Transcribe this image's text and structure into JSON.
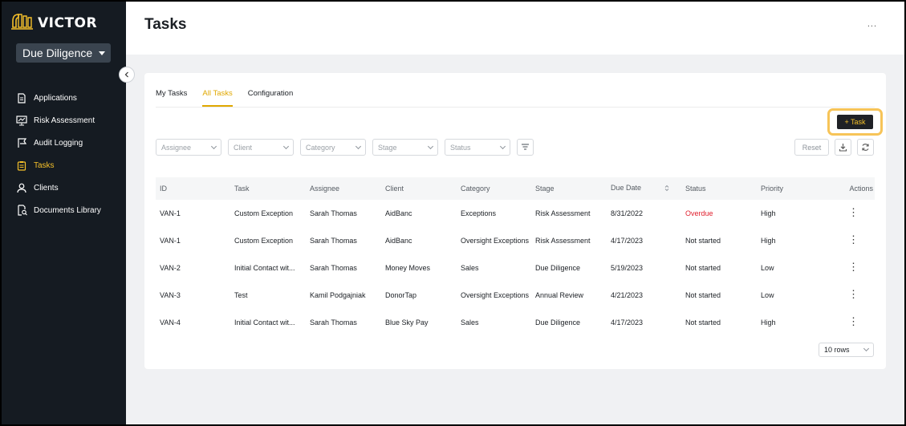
{
  "app": {
    "logo_text": "VICTOR",
    "product": "Due Diligence"
  },
  "sidebar": {
    "items": [
      {
        "label": "Applications",
        "icon": "document-icon",
        "active": false
      },
      {
        "label": "Risk Assessment",
        "icon": "chart-board-icon",
        "active": false
      },
      {
        "label": "Audit Logging",
        "icon": "flag-icon",
        "active": false
      },
      {
        "label": "Tasks",
        "icon": "clipboard-icon",
        "active": true
      },
      {
        "label": "Clients",
        "icon": "user-icon",
        "active": false
      },
      {
        "label": "Documents Library",
        "icon": "document-search-icon",
        "active": false
      }
    ]
  },
  "header": {
    "title": "Tasks",
    "more_label": "..."
  },
  "tabs": [
    {
      "label": "My Tasks",
      "active": false
    },
    {
      "label": "All Tasks",
      "active": true
    },
    {
      "label": "Configuration",
      "active": false
    }
  ],
  "toolbar": {
    "add_task_label": "+ Task",
    "reset_label": "Reset"
  },
  "filters": [
    {
      "placeholder": "Assignee"
    },
    {
      "placeholder": "Client"
    },
    {
      "placeholder": "Category"
    },
    {
      "placeholder": "Stage"
    },
    {
      "placeholder": "Status"
    }
  ],
  "table": {
    "columns": [
      "ID",
      "Task",
      "Assignee",
      "Client",
      "Category",
      "Stage",
      "Due Date",
      "Status",
      "Priority",
      "Actions"
    ],
    "rows": [
      {
        "id": "VAN-1",
        "task": "Custom Exception",
        "assignee": "Sarah Thomas",
        "client": "AidBanc",
        "category": "Exceptions",
        "stage": "Risk Assessment",
        "due_date": "8/31/2022",
        "status": "Overdue",
        "priority": "High"
      },
      {
        "id": "VAN-1",
        "task": "Custom Exception",
        "assignee": "Sarah Thomas",
        "client": "AidBanc",
        "category": "Oversight Exceptions",
        "stage": "Risk Assessment",
        "due_date": "4/17/2023",
        "status": "Not started",
        "priority": "High"
      },
      {
        "id": "VAN-2",
        "task": "Initial Contact wit...",
        "assignee": "Sarah Thomas",
        "client": "Money Moves",
        "category": "Sales",
        "stage": "Due Diligence",
        "due_date": "5/19/2023",
        "status": "Not started",
        "priority": "Low"
      },
      {
        "id": "VAN-3",
        "task": "Test",
        "assignee": "Kamil Podgajniak",
        "client": "DonorTap",
        "category": "Oversight Exceptions",
        "stage": "Annual Review",
        "due_date": "4/21/2023",
        "status": "Not started",
        "priority": "Low"
      },
      {
        "id": "VAN-4",
        "task": "Initial Contact wit...",
        "assignee": "Sarah Thomas",
        "client": "Blue Sky Pay",
        "category": "Sales",
        "stage": "Due Diligence",
        "due_date": "4/17/2023",
        "status": "Not started",
        "priority": "High"
      }
    ]
  },
  "pagination": {
    "rows_per_page": "10 rows"
  },
  "colors": {
    "accent": "#f5c02a",
    "sidebar_bg": "#151b22",
    "overdue": "#e0202e"
  }
}
